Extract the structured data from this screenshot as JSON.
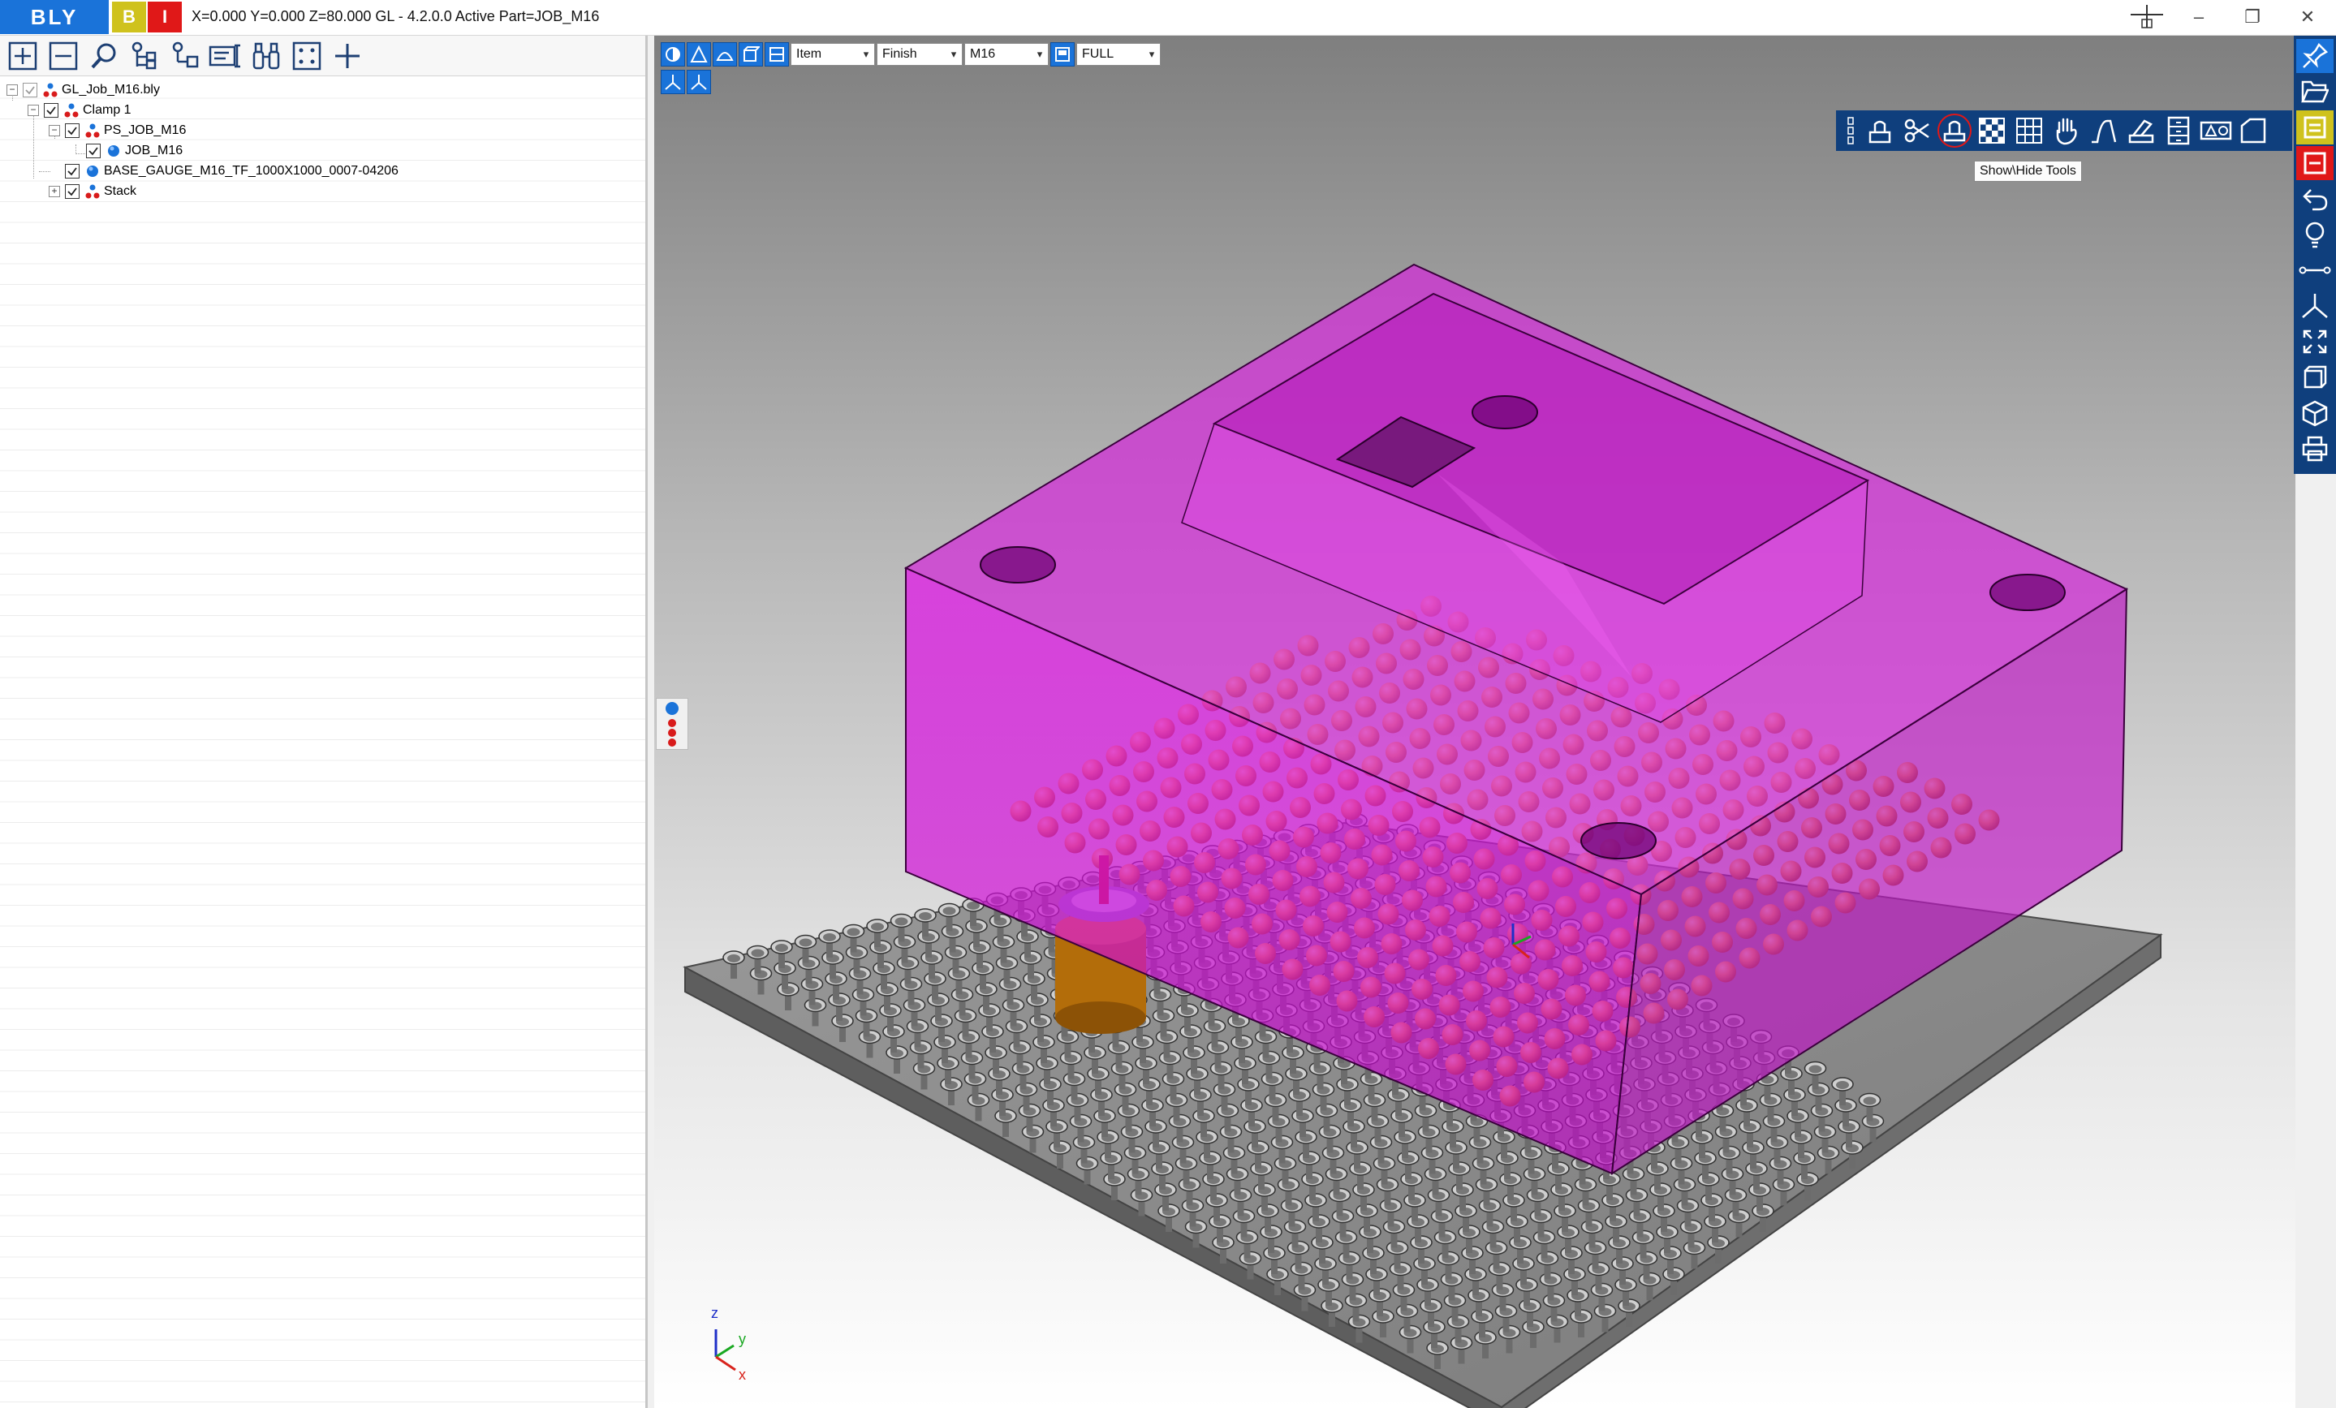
{
  "titlebar": {
    "logo": "BLY",
    "btn_yellow": "B",
    "btn_red": "I",
    "title": "X=0.000 Y=0.000 Z=80.000   GL - 4.2.0.0 Active Part=JOB_M16",
    "minimize": "–",
    "restore": "❐",
    "close": "✕"
  },
  "left_toolbar": {
    "icons": [
      "expand-all-icon",
      "collapse-all-icon",
      "search-icon",
      "tree-structure-icon",
      "tree-branch-icon",
      "properties-icon",
      "binoculars-icon",
      "select-frame-icon",
      "add-icon"
    ]
  },
  "tree": {
    "items": [
      {
        "label": "GL_Job_M16.bly",
        "icon": "assembly-icon"
      },
      {
        "label": "Clamp 1",
        "icon": "assembly-icon"
      },
      {
        "label": "PS_JOB_M16",
        "icon": "assembly-icon"
      },
      {
        "label": "JOB_M16",
        "icon": "part-icon"
      },
      {
        "label": "BASE_GAUGE_M16_TF_1000X1000_0007-04206",
        "icon": "part-icon"
      },
      {
        "label": "Stack",
        "icon": "assembly-icon"
      }
    ]
  },
  "viewport_toolbar": {
    "select_item": "Item",
    "select_finish": "Finish",
    "select_material": "M16",
    "select_view": "FULL"
  },
  "tooltip": "Show\\Hide Tools",
  "axes": {
    "z": "z",
    "y": "y",
    "x": "x"
  },
  "colors": {
    "brand_blue": "#1a73d9",
    "toolbar_navy": "#0f3f7d",
    "part_magenta": "#d200d8",
    "pin_orange": "#f2a23a",
    "base_gray": "#8a8a8a"
  }
}
